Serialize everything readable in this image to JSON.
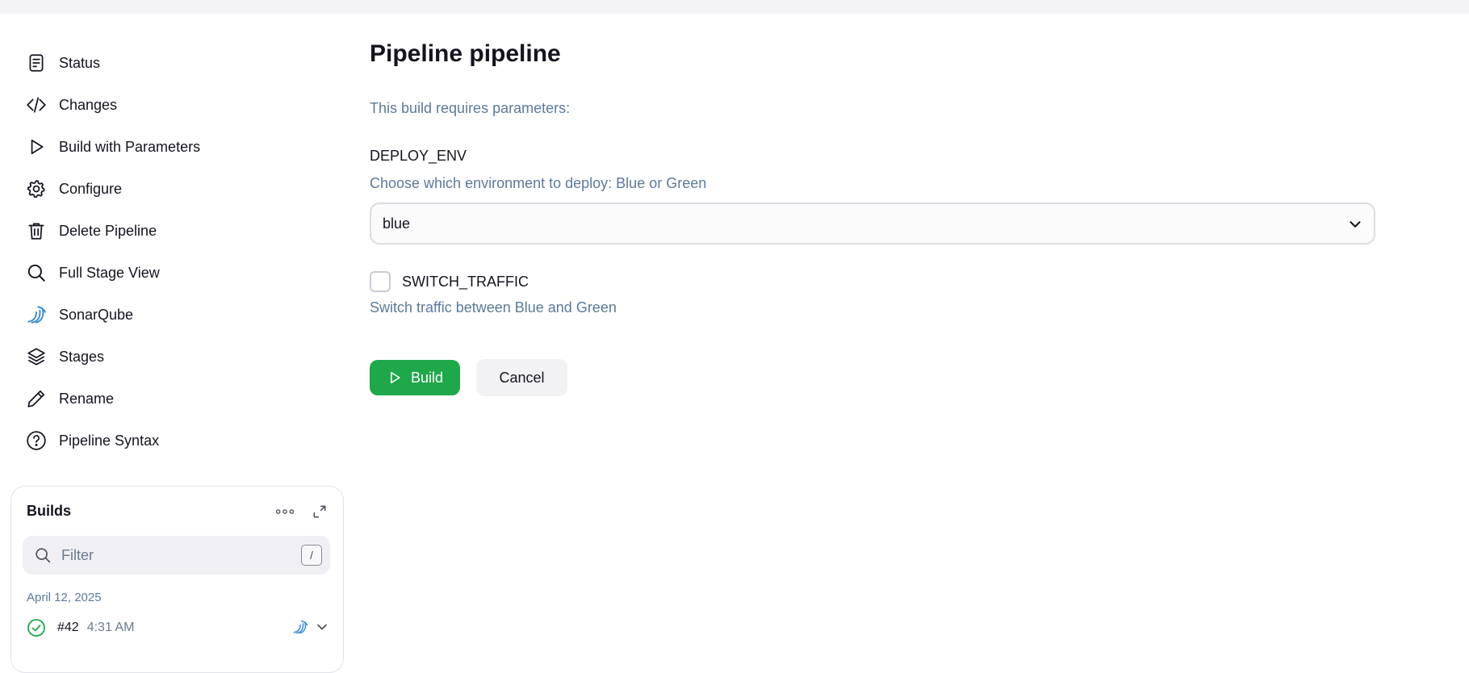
{
  "sidebar": {
    "items": [
      {
        "label": "Status",
        "icon": "document-icon"
      },
      {
        "label": "Changes",
        "icon": "code-icon"
      },
      {
        "label": "Build with Parameters",
        "icon": "play-icon"
      },
      {
        "label": "Configure",
        "icon": "gear-icon"
      },
      {
        "label": "Delete Pipeline",
        "icon": "trash-icon"
      },
      {
        "label": "Full Stage View",
        "icon": "search-icon"
      },
      {
        "label": "SonarQube",
        "icon": "sonarqube-icon"
      },
      {
        "label": "Stages",
        "icon": "layers-icon"
      },
      {
        "label": "Rename",
        "icon": "pencil-icon"
      },
      {
        "label": "Pipeline Syntax",
        "icon": "help-icon"
      }
    ]
  },
  "builds": {
    "title": "Builds",
    "filter_placeholder": "Filter",
    "filter_shortcut": "/",
    "date": "April 12, 2025",
    "items": [
      {
        "number": "#42",
        "time": "4:31 AM",
        "status": "success"
      }
    ]
  },
  "main": {
    "title": "Pipeline pipeline",
    "intro": "This build requires parameters:",
    "params": {
      "deploy_env": {
        "name": "DEPLOY_ENV",
        "description": "Choose which environment to deploy: Blue or Green",
        "selected": "blue"
      },
      "switch_traffic": {
        "name": "SWITCH_TRAFFIC",
        "description": "Switch traffic between Blue and Green",
        "checked": false
      }
    },
    "actions": {
      "build_label": "Build",
      "cancel_label": "Cancel"
    }
  },
  "colors": {
    "accent_green": "#1fa84a",
    "muted_text": "#5b7a9c",
    "sonar_blue": "#3d8fd6"
  }
}
